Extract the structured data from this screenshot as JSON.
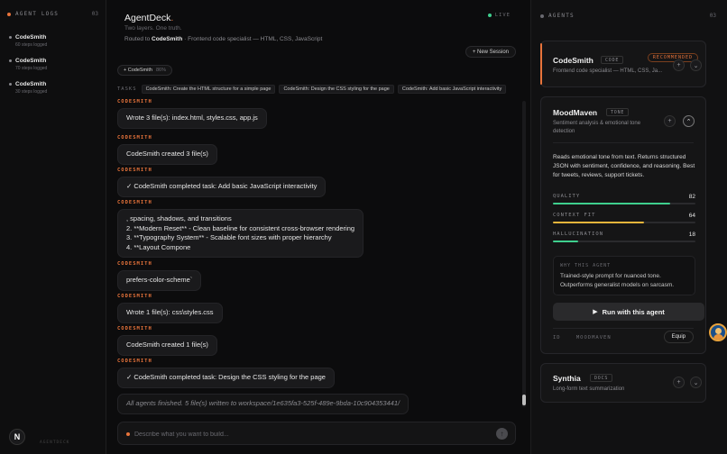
{
  "sidebar": {
    "title": "AGENT LOGS",
    "count": "03",
    "items": [
      {
        "name": "CodeSmith",
        "sub": "60 steps logged"
      },
      {
        "name": "CodeSmith",
        "sub": "70 steps logged"
      },
      {
        "name": "CodeSmith",
        "sub": "30 steps logged"
      }
    ],
    "logo_letter": "N",
    "footer": "AGENTDECK"
  },
  "header": {
    "title": "AgentDeck",
    "title_dot": ".",
    "tagline": "Two layers. One truth.",
    "routed_prefix": "Routed to",
    "routed_agent": "CodeSmith",
    "routed_suffix": "· Frontend code specialist — HTML, CSS, JavaScript",
    "live": "LIVE",
    "new_session": "+ New Session"
  },
  "chip": {
    "label": "+ CodeSmith",
    "pct": "86%"
  },
  "tasks": {
    "label": "TASKS",
    "items": [
      "CodeSmith: Create the HTML structure for a simple page",
      "CodeSmith: Design the CSS styling for the page",
      "CodeSmith: Add basic JavaScript interactivity"
    ]
  },
  "messages": [
    {
      "who": "CODESMITH",
      "lines": [
        "Wrote 3 file(s): index.html, styles.css, app.js"
      ]
    },
    {
      "who": "CODESMITH",
      "lines": [
        "CodeSmith created 3 file(s)"
      ]
    },
    {
      "who": "CODESMITH",
      "lines": [
        "✓ CodeSmith completed task: Add basic JavaScript interactivity"
      ]
    },
    {
      "who": "CODESMITH",
      "lines": [
        ", spacing, shadows, and transitions",
        "2. **Modern Reset** - Clean baseline for consistent cross-browser rendering",
        "3. **Typography System** - Scalable font sizes with proper hierarchy",
        "4. **Layout Compone"
      ]
    },
    {
      "who": "CODESMITH",
      "lines": [
        "prefers-color-scheme`"
      ]
    },
    {
      "who": "CODESMITH",
      "lines": [
        "Wrote 1 file(s): css\\styles.css"
      ]
    },
    {
      "who": "CODESMITH",
      "lines": [
        "CodeSmith created 1 file(s)"
      ]
    },
    {
      "who": "CODESMITH",
      "lines": [
        "✓ CodeSmith completed task: Design the CSS styling for the page"
      ]
    },
    {
      "who": "",
      "lines": [
        "All agents finished. 5 file(s) written to workspace/1e635fa3-525f-489e-9bda-10c904353441/"
      ]
    }
  ],
  "input": {
    "placeholder": "Describe what you want to build...",
    "send": "↑"
  },
  "agents_panel": {
    "title": "AGENTS",
    "count": "03",
    "codesmith": {
      "name": "CodeSmith",
      "tag": "CODE",
      "badge": "RECOMMENDED",
      "desc": "Frontend code specialist — HTML, CSS, Ja..."
    },
    "moodmaven": {
      "name": "MoodMaven",
      "tag": "TONE",
      "desc_line1": "Sentiment analysis & emotional tone",
      "desc_line2": "detection",
      "long_desc": "Reads emotional tone from text. Returns structured JSON with sentiment, confidence, and reasoning. Best for tweets, reviews, support tickets.",
      "metrics": [
        {
          "label": "QUALITY",
          "value": "82",
          "fraction": 0.82,
          "color": "#3fcf8e"
        },
        {
          "label": "CONTEXT FIT",
          "value": "64",
          "fraction": 0.64,
          "color": "#e8b53b"
        },
        {
          "label": "HALLUCINATION",
          "value": "18",
          "fraction": 0.18,
          "color": "#3fcf8e"
        }
      ],
      "why_title": "WHY THIS AGENT",
      "why_text": "Trained-style prompt for nuanced tone. Outperforms generalist models on sarcasm.",
      "run_label": "Run with this agent",
      "id_label": "ID",
      "id_value": "MOODMAVEN",
      "equip_label": "Equip"
    },
    "synthia": {
      "name": "Synthia",
      "tag": "DOCS",
      "desc": "Long-form text summarization"
    }
  }
}
